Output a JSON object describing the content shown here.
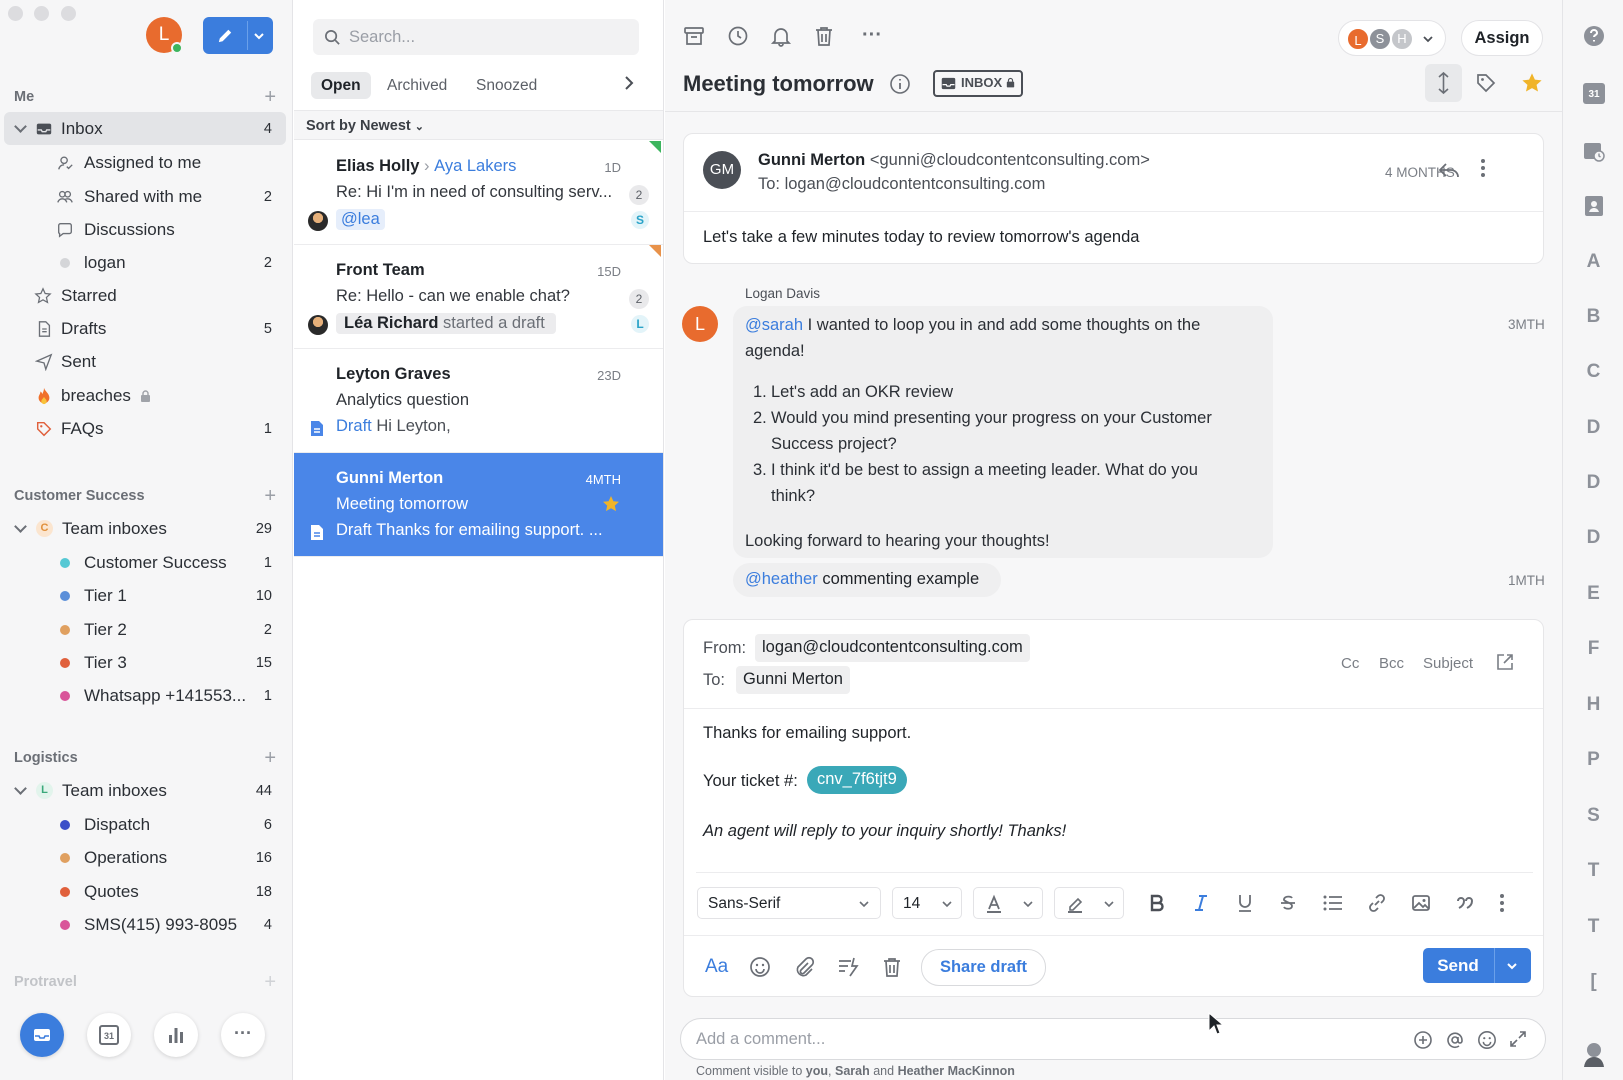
{
  "sidebar": {
    "avatar_initial": "L",
    "sections": {
      "me": "Me",
      "customer_success": "Customer Success",
      "logistics": "Logistics",
      "protravel": "Protravel"
    },
    "me_items": [
      {
        "label": "Inbox",
        "count": "4"
      },
      {
        "label": "Assigned to me",
        "count": ""
      },
      {
        "label": "Shared with me",
        "count": "2"
      },
      {
        "label": "Discussions",
        "count": ""
      },
      {
        "label": "logan",
        "count": "2"
      },
      {
        "label": "Starred",
        "count": ""
      },
      {
        "label": "Drafts",
        "count": "5"
      },
      {
        "label": "Sent",
        "count": ""
      },
      {
        "label": "breaches",
        "count": ""
      },
      {
        "label": "FAQs",
        "count": "1"
      }
    ],
    "cs_group": {
      "initial": "C",
      "label": "Team inboxes",
      "count": "29"
    },
    "cs_items": [
      {
        "label": "Customer Success",
        "count": "1",
        "color": "#55c8d4"
      },
      {
        "label": "Tier 1",
        "count": "10",
        "color": "#5b8fd9"
      },
      {
        "label": "Tier 2",
        "count": "2",
        "color": "#e0a060"
      },
      {
        "label": "Tier 3",
        "count": "15",
        "color": "#e0603c"
      },
      {
        "label": "Whatsapp +141553...",
        "count": "1",
        "color": "#d9559a"
      }
    ],
    "log_group": {
      "initial": "L",
      "label": "Team inboxes",
      "count": "44"
    },
    "log_items": [
      {
        "label": "Dispatch",
        "count": "6",
        "color": "#3b4fc8"
      },
      {
        "label": "Operations",
        "count": "16",
        "color": "#e0a060"
      },
      {
        "label": "Quotes",
        "count": "18",
        "color": "#e0603c"
      },
      {
        "label": "SMS(415) 993-8095",
        "count": "4",
        "color": "#d9559a"
      }
    ],
    "bottom": {
      "calendar_day": "31",
      "more": "···"
    }
  },
  "list": {
    "search_placeholder": "Search...",
    "tabs": [
      "Open",
      "Archived",
      "Snoozed"
    ],
    "sort_label": "Sort by Newest",
    "conversations": [
      {
        "from": "Elias Holly",
        "to": "Aya Lakers",
        "time": "1D",
        "subject": "Re: Hi I'm in need of consulting serv...",
        "count": "2",
        "mention": "@lea",
        "assignee": "S"
      },
      {
        "from": "Front Team",
        "time": "15D",
        "subject": "Re: Hello - can we enable chat?",
        "count": "2",
        "drafter": "Léa Richard",
        "draft_text": "started a draft",
        "assignee": "L"
      },
      {
        "from": "Leyton Graves",
        "time": "23D",
        "subject": "Analytics question",
        "draft_label": "Draft",
        "draft_text": "Hi Leyton,"
      },
      {
        "from": "Gunni Merton",
        "time": "4MTH",
        "subject": "Meeting tomorrow",
        "draft_label": "Draft",
        "draft_text": "Thanks for emailing support. ..."
      }
    ]
  },
  "toolbar": {
    "assign_label": "Assign",
    "assignees": [
      "L",
      "S",
      "H"
    ],
    "more": "···"
  },
  "thread": {
    "title": "Meeting tomorrow",
    "inbox_tag": "INBOX",
    "email": {
      "initials": "GM",
      "from_name": "Gunni Merton",
      "from_addr": "<gunni@cloudcontentconsulting.com>",
      "to": "To: logan@cloudcontentconsulting.com",
      "time": "4 MONTHS",
      "body": "Let's take a few minutes today to review tomorrow's agenda"
    },
    "comment": {
      "author": "Logan Davis",
      "initial": "L",
      "time": "3MTH",
      "mention": "@sarah",
      "intro": "I wanted to loop you in and add some thoughts on the",
      "intro2": "agenda!",
      "items": [
        {
          "n": "1.",
          "line1": "Let's add an OKR review",
          "line2": ""
        },
        {
          "n": "2.",
          "line1": "Would you mind presenting your progress on your Customer",
          "line2": "Success project?"
        },
        {
          "n": "3.",
          "line1": "I think it'd be best to assign a meeting leader. What do you",
          "line2": "think?"
        }
      ],
      "outro": "Looking forward to hearing your thoughts!"
    },
    "comment2": {
      "mention": "@heather",
      "text": "commenting example",
      "time": "1MTH"
    }
  },
  "composer": {
    "from_label": "From:",
    "from_value": "logan@cloudcontentconsulting.com",
    "to_label": "To:",
    "to_value": "Gunni Merton",
    "cc": "Cc",
    "bcc": "Bcc",
    "subject": "Subject",
    "line1": "Thanks for emailing support.",
    "ticket_label": "Your ticket #:",
    "ticket_value": "cnv_7f6tjt9",
    "line3": "An agent will reply to your inquiry shortly! Thanks!",
    "font": "Sans-Serif",
    "size": "14",
    "aa": "Aa",
    "share_draft": "Share draft",
    "send": "Send"
  },
  "comment_box": {
    "placeholder": "Add a comment...",
    "visibility_prefix": "Comment visible to",
    "you": "you",
    "sep1": ",",
    "sarah": "Sarah",
    "and": "and",
    "heather": "Heather MacKinnon"
  },
  "rail": {
    "calendar_day": "31",
    "letters": [
      "A",
      "B",
      "C",
      "D",
      "D",
      "D",
      "E",
      "F",
      "H",
      "P",
      "S",
      "T",
      "T",
      "["
    ]
  },
  "colors": {
    "accent": "#4a86e8",
    "orange": "#e86b2e",
    "star": "#f0b429",
    "teal": "#3aa8b8"
  }
}
